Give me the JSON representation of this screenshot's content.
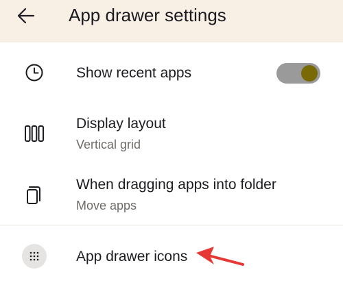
{
  "header": {
    "title": "App drawer settings",
    "back_icon": "arrow-left-icon",
    "background": "#f8efe5"
  },
  "settings": [
    {
      "title": "Show recent apps",
      "icon": "clock-icon",
      "toggle": true
    },
    {
      "title": "Display layout",
      "subtitle": "Vertical grid",
      "icon": "columns-icon"
    },
    {
      "title": "When dragging apps into folder",
      "subtitle": "Move apps",
      "icon": "copy-icon"
    },
    {
      "title": "App drawer icons",
      "icon": "grid-dots-icon"
    }
  ],
  "colors": {
    "toggle_track": "#9a9a9a",
    "toggle_knob": "#7a6a05",
    "annotation_arrow": "#e53935"
  }
}
